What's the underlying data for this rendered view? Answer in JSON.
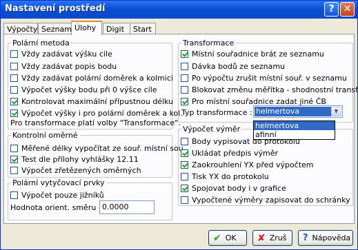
{
  "window": {
    "title": "Nastavení prostředí",
    "help_button": "?",
    "close_button": "✕"
  },
  "tabs": [
    {
      "label": "Výpočty",
      "active": false
    },
    {
      "label": "Seznam",
      "active": false
    },
    {
      "label": "Úlohy",
      "active": true
    },
    {
      "label": "Digit",
      "active": false
    },
    {
      "label": "Start",
      "active": false
    }
  ],
  "polarni_metoda": {
    "title": "Polární metoda",
    "items": [
      {
        "label": "Vždy zadávat výšku cíle",
        "checked": false
      },
      {
        "label": "Vždy zadávat popis bodu",
        "checked": false
      },
      {
        "label": "Vždy zadávat polární doměrek a kolmici",
        "checked": false
      },
      {
        "label": "Výpočet výšky bodu při 0 výšce cíle",
        "checked": false
      },
      {
        "label": "Kontrolovat maximální přípustnou délku",
        "checked": true
      },
      {
        "label": "Výpočet výšky i pro polární doměrek a kol.",
        "checked": true
      }
    ],
    "note": "Pro transformace platí volby  \"Transformace\"."
  },
  "kontrolni_omerne": {
    "title": "Kontrolní oměrné",
    "items": [
      {
        "label": "Měřené délky vypočítat ze souř. místní sou",
        "checked": false
      },
      {
        "label": "Test dle přílohy vyhlášky 12.11",
        "checked": true
      },
      {
        "label": "Výpočet zřetězených oměrných",
        "checked": false
      }
    ]
  },
  "vytycovaci": {
    "title": "Polární vytyčovací prvky",
    "items": [
      {
        "label": "Výpočet pouze jižníků",
        "checked": false
      }
    ],
    "orient_label": "Hodnota orient. směru",
    "orient_value": "0.0000"
  },
  "transformace": {
    "title": "Transformace",
    "items": [
      {
        "label": "Místní souřadnice brát ze seznamu",
        "checked": true
      },
      {
        "label": "Dávka bodů ze seznamu",
        "checked": false
      },
      {
        "label": "Po výpočtu zrušit místní souř. v seznamu",
        "checked": false
      },
      {
        "label": "Blokovat změnu měřítka - shodnostní transf",
        "checked": false
      },
      {
        "label": "Pro místní souřadnice zadat jiné ČB",
        "checked": true
      }
    ],
    "type_label": "Typ transformace :",
    "type_value": "helmertova",
    "type_options": [
      "helmertova",
      "afinní"
    ]
  },
  "vypocet_vymer": {
    "title": "Výpočet výměr",
    "items": [
      {
        "label": "Body vypisovat do protokolu",
        "checked": false
      },
      {
        "label": "Ukládat předpis výměr",
        "checked": true
      },
      {
        "label": "Zaokrouhlení YX před výpočtem",
        "checked": true
      },
      {
        "label": "Tisk YX do protokolu",
        "checked": false
      },
      {
        "label": "Spojovat body i v grafice",
        "checked": true
      },
      {
        "label": "Vypočtené výměry zapisovat do schránky",
        "checked": false
      }
    ]
  },
  "buttons": {
    "ok": "OK",
    "cancel": "Zruš",
    "help": "Nápověda"
  },
  "colors": {
    "title_bar": "#0a4fd6",
    "check_mark": "#21a121",
    "selection": "#316ac5"
  }
}
